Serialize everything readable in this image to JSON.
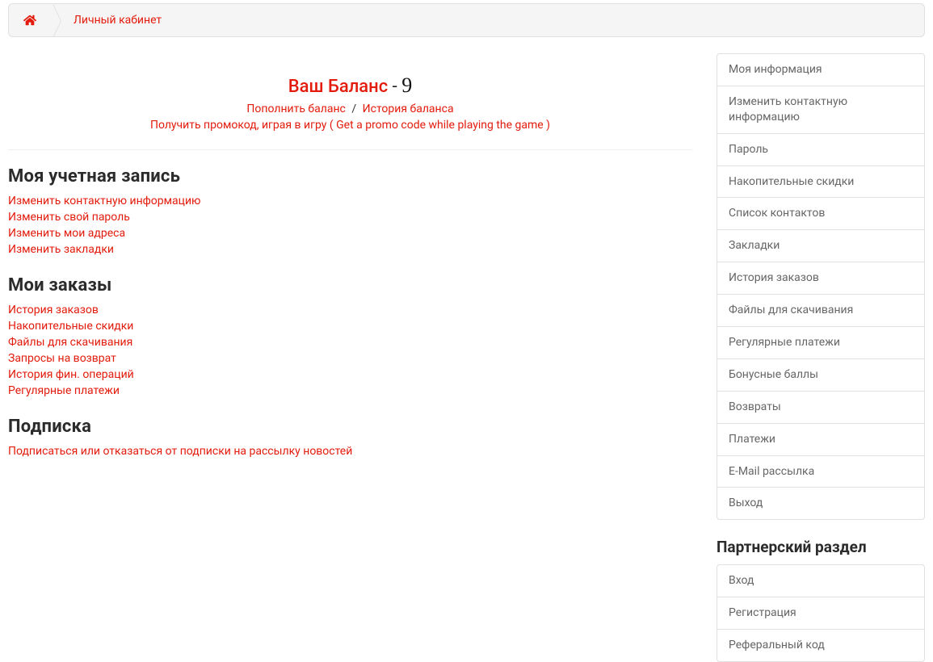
{
  "breadcrumb": {
    "home_label": "home",
    "current": "Личный кабинет"
  },
  "balance": {
    "title": "Ваш Баланс",
    "dash": " - ",
    "value": "9",
    "topup": "Пополнить баланс",
    "separator": "/",
    "history": "История баланса",
    "promo": "Получить промокод, играя в игру ( Get a promo code while playing the game )"
  },
  "sections": {
    "account": {
      "title": "Моя учетная запись",
      "links": [
        "Изменить контактную информацию",
        "Изменить свой пароль",
        "Изменить мои адреса",
        "Изменить закладки"
      ]
    },
    "orders": {
      "title": "Мои заказы",
      "links": [
        "История заказов",
        "Накопительные скидки",
        "Файлы для скачивания",
        "Запросы на возврат",
        "История фин. операций",
        "Регулярные платежи"
      ]
    },
    "subscription": {
      "title": "Подписка",
      "links": [
        "Подписаться или отказаться от подписки на рассылку новостей"
      ]
    }
  },
  "sidebar": {
    "main_items": [
      "Моя информация",
      "Изменить контактную информацию",
      "Пароль",
      "Накопительные скидки",
      "Список контактов",
      "Закладки",
      "История заказов",
      "Файлы для скачивания",
      "Регулярные платежи",
      "Бонусные баллы",
      "Возвраты",
      "Платежи",
      "E-Mail рассылка",
      "Выход"
    ],
    "affiliate_title": "Партнерский раздел",
    "affiliate_items": [
      "Вход",
      "Регистрация",
      "Реферальный код"
    ]
  }
}
